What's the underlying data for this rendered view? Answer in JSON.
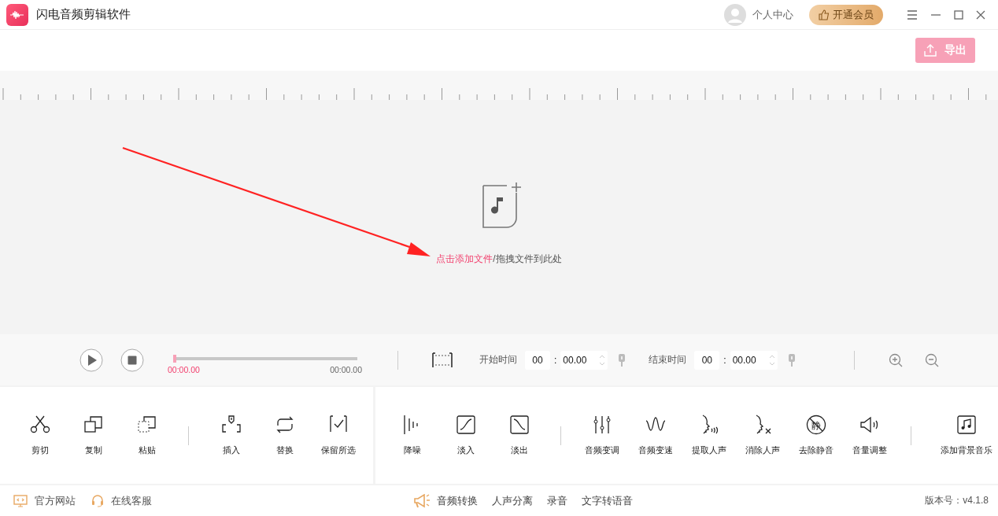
{
  "window": {
    "title": "闪电音频剪辑软件"
  },
  "user": {
    "label": "个人中心"
  },
  "vip_button": {
    "label": "开通会员"
  },
  "export_button": {
    "label": "导出",
    "disabled": true
  },
  "drop_zone": {
    "link": "点击添加文件",
    "hint": "/拖拽文件到此处"
  },
  "playback": {
    "level": 0,
    "current_time": "00:00.00",
    "total_time": "00:00.00"
  },
  "start_time": {
    "label": "开始时间",
    "minutes": "00",
    "separator": ":",
    "seconds": "00.00"
  },
  "end_time": {
    "label": "结束时间",
    "minutes": "00",
    "separator": ":",
    "seconds": "00.00"
  },
  "left_tools": [
    [
      {
        "label": "剪切"
      },
      {
        "label": "复制"
      },
      {
        "label": "粘贴"
      }
    ],
    [
      {
        "label": "插入"
      },
      {
        "label": "替换"
      },
      {
        "label": "保留所选"
      }
    ]
  ],
  "right_tools": [
    [
      {
        "label": "降噪"
      },
      {
        "label": "淡入"
      },
      {
        "label": "淡出"
      }
    ],
    [
      {
        "label": "音频变调"
      },
      {
        "label": "音频变速"
      },
      {
        "label": "提取人声"
      },
      {
        "label": "消除人声"
      },
      {
        "label": "去除静音",
        "icon_text": "静"
      },
      {
        "label": "音量调整"
      }
    ],
    [
      {
        "label": "添加背景音乐"
      }
    ]
  ],
  "footer": {
    "links": [
      "官方网站",
      "在线客服"
    ],
    "features": [
      "音频转换",
      "人声分离",
      "录音",
      "文字转语音"
    ],
    "version": "版本号：v4.1.8"
  }
}
